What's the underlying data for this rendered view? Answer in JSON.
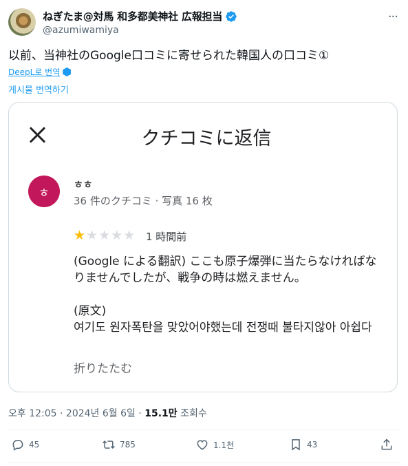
{
  "author": {
    "display_name": "ねぎたま@対馬 和多都美神社 広報担当",
    "handle": "@azumiwamiya"
  },
  "tweet": {
    "text": "以前、当神社のGoogle口コミに寄せられた韓国人の口コミ①",
    "deepl_label": "DeepL로 번역",
    "translate_label": "게시물 번역하기"
  },
  "card": {
    "title": "クチコミに返信",
    "reviewer_initial": "ㅎ",
    "reviewer_name": "ㅎㅎ",
    "reviewer_meta": "36 件のクチコミ · 写真 16 枚",
    "rating": 1,
    "rating_max": 5,
    "time": "1 時間前",
    "translated_text": "(Google による翻訳) ここも原子爆弾に当たらなければなりませんでしたが、戦争の時は燃えません。",
    "original_label": "(原文)",
    "original_text": "여기도 원자폭탄을 맞았어야했는데 전쟁때  불타지않아 아쉽다",
    "collapse_label": "折りたたむ"
  },
  "meta": {
    "time_date": "오후 12:05 · 2024년 6월 6일 · ",
    "views_count": "15.1만",
    "views_label": " 조회수"
  },
  "actions": {
    "replies": "45",
    "retweets": "785",
    "likes": "1.1천",
    "bookmarks": "43"
  },
  "colors": {
    "accent": "#1d9bf0",
    "star": "#fbbc04",
    "reviewer_avatar": "#c2185b"
  }
}
